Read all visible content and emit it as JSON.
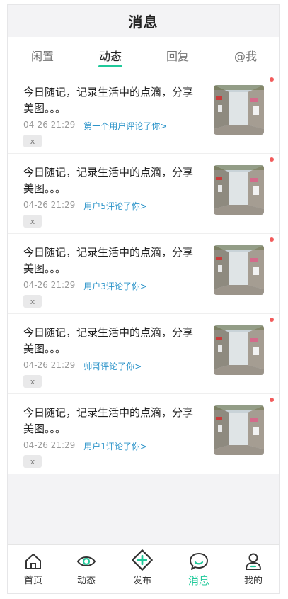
{
  "header": {
    "title": "消息"
  },
  "tabs": [
    {
      "label": "闲置",
      "active": false
    },
    {
      "label": "动态",
      "active": true
    },
    {
      "label": "回复",
      "active": false
    },
    {
      "label": "@我",
      "active": false
    }
  ],
  "items": [
    {
      "text": "今日随记，记录生活中的点滴，分享美图。。。",
      "time": "04-26 21:29",
      "action": "第一个用户评论了你>",
      "close": "x",
      "unread": true
    },
    {
      "text": "今日随记，记录生活中的点滴，分享美图。。。",
      "time": "04-26 21:29",
      "action": "用户5评论了你>",
      "close": "x",
      "unread": true
    },
    {
      "text": "今日随记，记录生活中的点滴，分享美图。。。",
      "time": "04-26 21:29",
      "action": "用户3评论了你>",
      "close": "x",
      "unread": true
    },
    {
      "text": "今日随记，记录生活中的点滴，分享美图。。。",
      "time": "04-26 21:29",
      "action": "帅哥评论了你>",
      "close": "x",
      "unread": true
    },
    {
      "text": "今日随记，记录生活中的点滴，分享美图。。。",
      "time": "04-26 21:29",
      "action": "用户1评论了你>",
      "close": "x",
      "unread": true
    }
  ],
  "tabbar": [
    {
      "label": "首页",
      "icon": "home-icon",
      "active": false
    },
    {
      "label": "动态",
      "icon": "eye-icon",
      "active": false
    },
    {
      "label": "发布",
      "icon": "publish-plus-icon",
      "active": false
    },
    {
      "label": "消息",
      "icon": "chat-bubble-icon",
      "active": true
    },
    {
      "label": "我的",
      "icon": "user-icon",
      "active": false
    }
  ],
  "colors": {
    "accent": "#1fc99a",
    "link": "#2a93c9",
    "unread_dot": "#f25c5c"
  }
}
